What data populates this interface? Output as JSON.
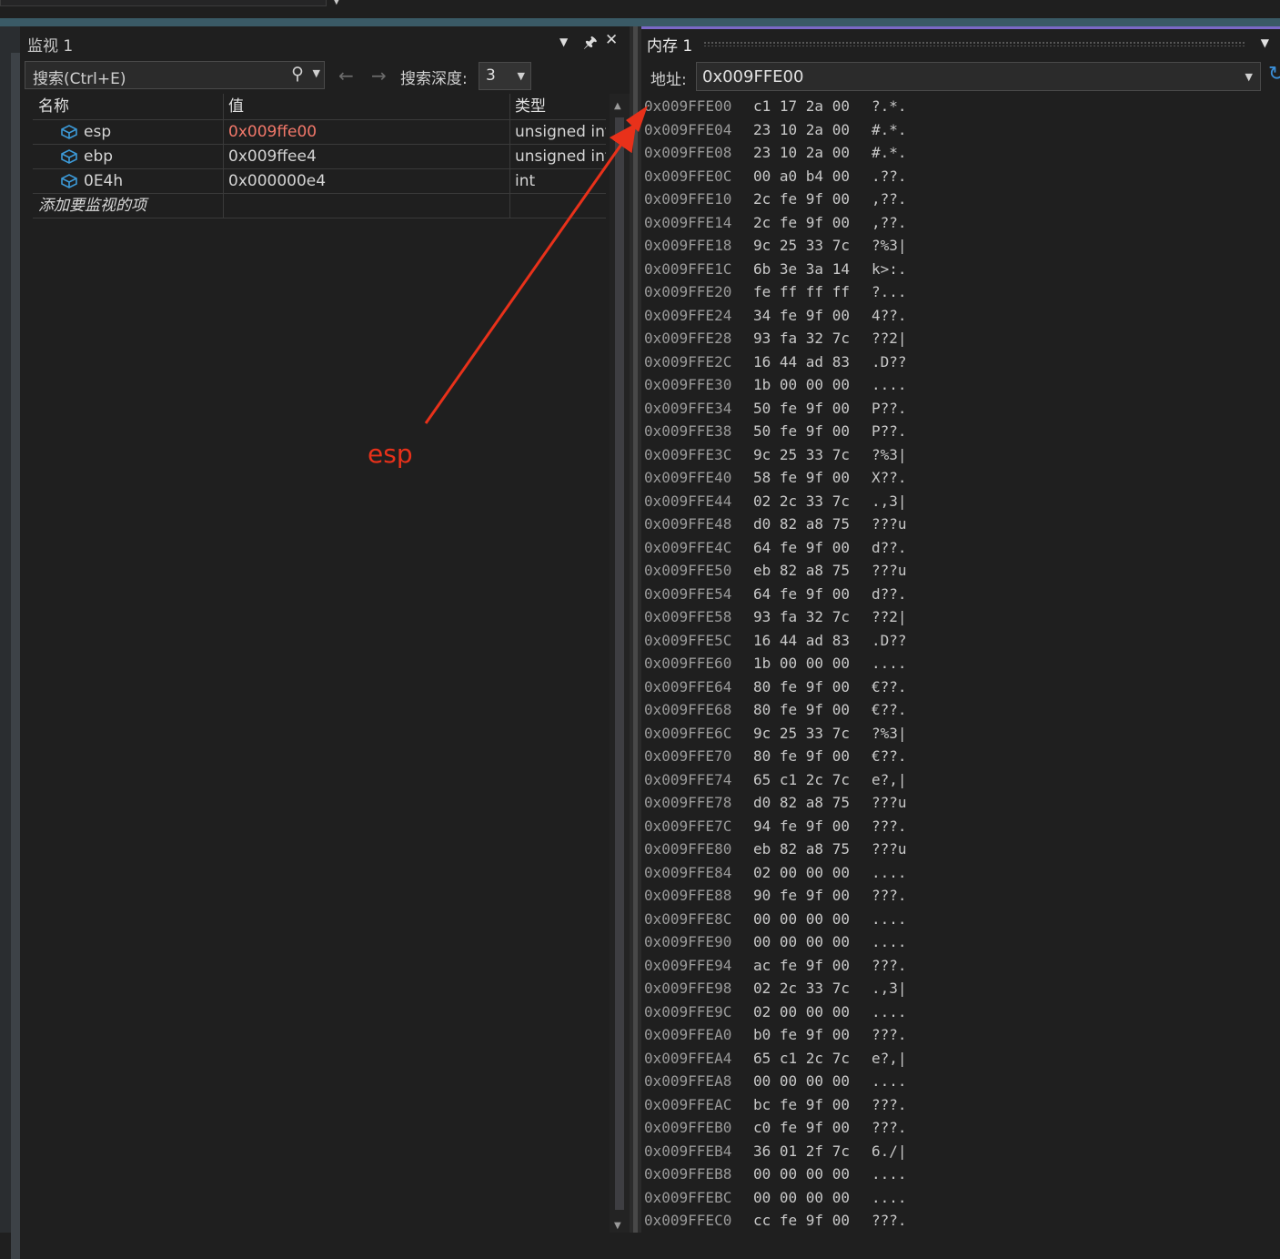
{
  "watch": {
    "title": "监视 1",
    "search_placeholder": "搜索(Ctrl+E)",
    "depth_label": "搜索深度:",
    "depth_value": "3",
    "columns": {
      "name": "名称",
      "value": "值",
      "type": "类型"
    },
    "rows": [
      {
        "name": "esp",
        "value": "0x009ffe00",
        "type": "unsigned int",
        "changed": true
      },
      {
        "name": "ebp",
        "value": "0x009ffee4",
        "type": "unsigned int",
        "changed": false
      },
      {
        "name": "0E4h",
        "value": "0x000000e4",
        "type": "int",
        "changed": false
      }
    ],
    "add_item": "添加要监视的项"
  },
  "memory": {
    "title": "内存 1",
    "address_label": "地址:",
    "address_value": "0x009FFE00",
    "lines": [
      {
        "addr": "0x009FFE00",
        "bytes": "c1 17 2a 00",
        "ascii": "?.*."
      },
      {
        "addr": "0x009FFE04",
        "bytes": "23 10 2a 00",
        "ascii": "#.*."
      },
      {
        "addr": "0x009FFE08",
        "bytes": "23 10 2a 00",
        "ascii": "#.*."
      },
      {
        "addr": "0x009FFE0C",
        "bytes": "00 a0 b4 00",
        "ascii": ".??."
      },
      {
        "addr": "0x009FFE10",
        "bytes": "2c fe 9f 00",
        "ascii": ",??."
      },
      {
        "addr": "0x009FFE14",
        "bytes": "2c fe 9f 00",
        "ascii": ",??."
      },
      {
        "addr": "0x009FFE18",
        "bytes": "9c 25 33 7c",
        "ascii": "?%3|"
      },
      {
        "addr": "0x009FFE1C",
        "bytes": "6b 3e 3a 14",
        "ascii": "k>:."
      },
      {
        "addr": "0x009FFE20",
        "bytes": "fe ff ff ff",
        "ascii": "?..."
      },
      {
        "addr": "0x009FFE24",
        "bytes": "34 fe 9f 00",
        "ascii": "4??."
      },
      {
        "addr": "0x009FFE28",
        "bytes": "93 fa 32 7c",
        "ascii": "??2|"
      },
      {
        "addr": "0x009FFE2C",
        "bytes": "16 44 ad 83",
        "ascii": ".D??"
      },
      {
        "addr": "0x009FFE30",
        "bytes": "1b 00 00 00",
        "ascii": "...."
      },
      {
        "addr": "0x009FFE34",
        "bytes": "50 fe 9f 00",
        "ascii": "P??."
      },
      {
        "addr": "0x009FFE38",
        "bytes": "50 fe 9f 00",
        "ascii": "P??."
      },
      {
        "addr": "0x009FFE3C",
        "bytes": "9c 25 33 7c",
        "ascii": "?%3|"
      },
      {
        "addr": "0x009FFE40",
        "bytes": "58 fe 9f 00",
        "ascii": "X??."
      },
      {
        "addr": "0x009FFE44",
        "bytes": "02 2c 33 7c",
        "ascii": ".,3|"
      },
      {
        "addr": "0x009FFE48",
        "bytes": "d0 82 a8 75",
        "ascii": "???u"
      },
      {
        "addr": "0x009FFE4C",
        "bytes": "64 fe 9f 00",
        "ascii": "d??."
      },
      {
        "addr": "0x009FFE50",
        "bytes": "eb 82 a8 75",
        "ascii": "???u"
      },
      {
        "addr": "0x009FFE54",
        "bytes": "64 fe 9f 00",
        "ascii": "d??."
      },
      {
        "addr": "0x009FFE58",
        "bytes": "93 fa 32 7c",
        "ascii": "??2|"
      },
      {
        "addr": "0x009FFE5C",
        "bytes": "16 44 ad 83",
        "ascii": ".D??"
      },
      {
        "addr": "0x009FFE60",
        "bytes": "1b 00 00 00",
        "ascii": "...."
      },
      {
        "addr": "0x009FFE64",
        "bytes": "80 fe 9f 00",
        "ascii": "€??."
      },
      {
        "addr": "0x009FFE68",
        "bytes": "80 fe 9f 00",
        "ascii": "€??."
      },
      {
        "addr": "0x009FFE6C",
        "bytes": "9c 25 33 7c",
        "ascii": "?%3|"
      },
      {
        "addr": "0x009FFE70",
        "bytes": "80 fe 9f 00",
        "ascii": "€??."
      },
      {
        "addr": "0x009FFE74",
        "bytes": "65 c1 2c 7c",
        "ascii": "e?,|"
      },
      {
        "addr": "0x009FFE78",
        "bytes": "d0 82 a8 75",
        "ascii": "???u"
      },
      {
        "addr": "0x009FFE7C",
        "bytes": "94 fe 9f 00",
        "ascii": "???."
      },
      {
        "addr": "0x009FFE80",
        "bytes": "eb 82 a8 75",
        "ascii": "???u"
      },
      {
        "addr": "0x009FFE84",
        "bytes": "02 00 00 00",
        "ascii": "...."
      },
      {
        "addr": "0x009FFE88",
        "bytes": "90 fe 9f 00",
        "ascii": "???."
      },
      {
        "addr": "0x009FFE8C",
        "bytes": "00 00 00 00",
        "ascii": "...."
      },
      {
        "addr": "0x009FFE90",
        "bytes": "00 00 00 00",
        "ascii": "...."
      },
      {
        "addr": "0x009FFE94",
        "bytes": "ac fe 9f 00",
        "ascii": "???."
      },
      {
        "addr": "0x009FFE98",
        "bytes": "02 2c 33 7c",
        "ascii": ".,3|"
      },
      {
        "addr": "0x009FFE9C",
        "bytes": "02 00 00 00",
        "ascii": "...."
      },
      {
        "addr": "0x009FFEA0",
        "bytes": "b0 fe 9f 00",
        "ascii": "???."
      },
      {
        "addr": "0x009FFEA4",
        "bytes": "65 c1 2c 7c",
        "ascii": "e?,|"
      },
      {
        "addr": "0x009FFEA8",
        "bytes": "00 00 00 00",
        "ascii": "...."
      },
      {
        "addr": "0x009FFEAC",
        "bytes": "bc fe 9f 00",
        "ascii": "???."
      },
      {
        "addr": "0x009FFEB0",
        "bytes": "c0 fe 9f 00",
        "ascii": "???."
      },
      {
        "addr": "0x009FFEB4",
        "bytes": "36 01 2f 7c",
        "ascii": "6./|"
      },
      {
        "addr": "0x009FFEB8",
        "bytes": "00 00 00 00",
        "ascii": "...."
      },
      {
        "addr": "0x009FFEBC",
        "bytes": "00 00 00 00",
        "ascii": "...."
      },
      {
        "addr": "0x009FFEC0",
        "bytes": "cc fe 9f 00",
        "ascii": "???."
      }
    ]
  },
  "annotation": {
    "text": "esp",
    "color": "#e8311a"
  },
  "colors": {
    "accent": "#7b68c6",
    "changed_value": "#f2786a",
    "background": "#1f1f1f"
  },
  "icons": [
    "search-icon",
    "chevron-down-icon",
    "pin-icon",
    "close-icon",
    "arrow-left-icon",
    "arrow-right-icon",
    "variable-cube-icon",
    "refresh-icon"
  ]
}
